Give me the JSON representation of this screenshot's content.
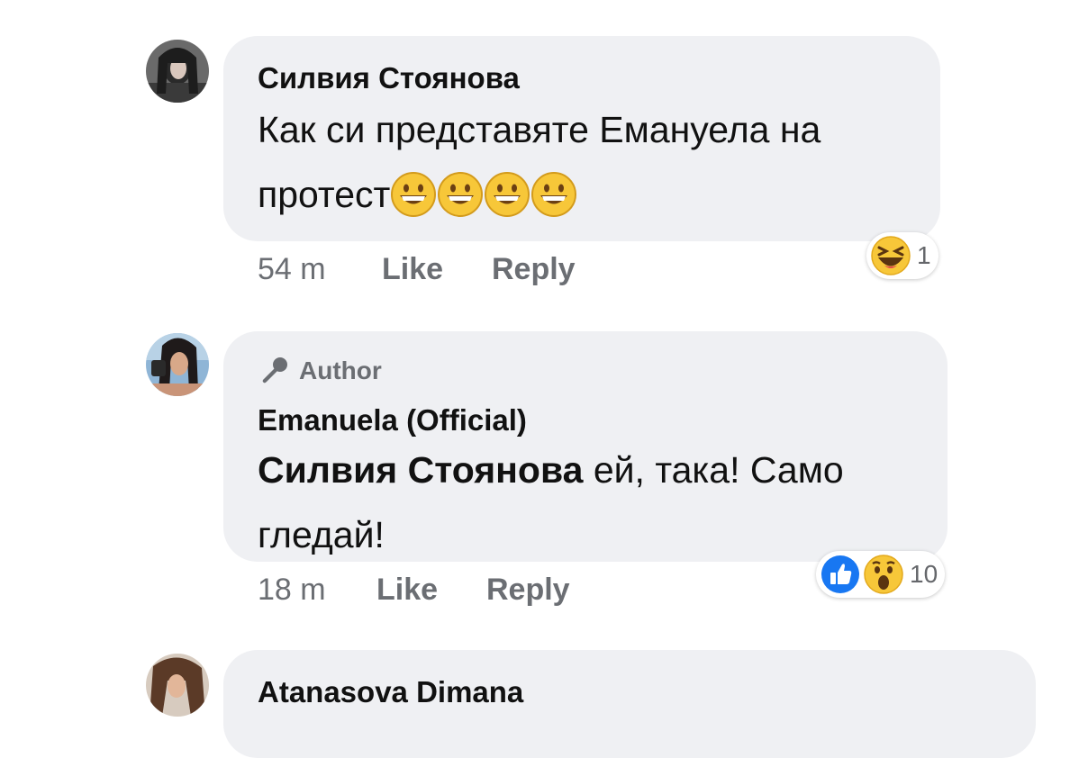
{
  "comments": [
    {
      "author": "Силвия Стоянова",
      "text": "Как си представяте Емануела на протест",
      "emoji_count_icon": "grinning-face-emoji",
      "time": "54 m",
      "like_label": "Like",
      "reply_label": "Reply",
      "reaction_icon": "laughing-face-icon",
      "reaction_count": "1"
    },
    {
      "badge": "Author",
      "badge_icon": "microphone-icon",
      "author": "Emanuela (Official)",
      "mention": "Силвия Стоянова",
      "text": " ей, така! Само гледай!",
      "time": "18 m",
      "like_label": "Like",
      "reply_label": "Reply",
      "reaction_icons": [
        "like-icon",
        "wow-face-icon"
      ],
      "reaction_count": "10"
    },
    {
      "author": "Atanasova Dimana"
    }
  ],
  "colors": {
    "bubble": "#eff0f3",
    "meta_text": "#6b6e73",
    "like_blue": "#1877f2",
    "emoji_yellow": "#f7c739"
  }
}
